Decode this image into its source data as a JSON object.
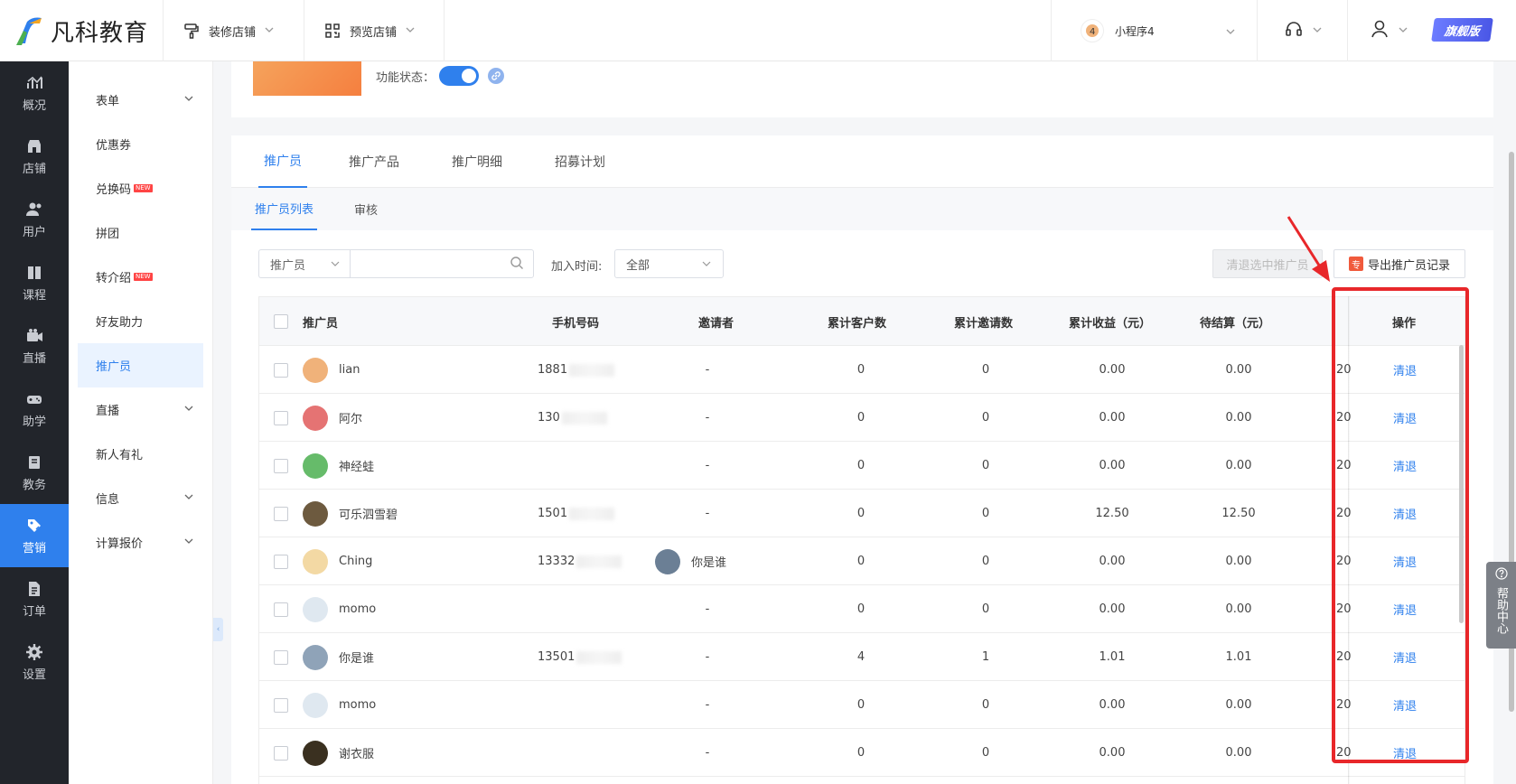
{
  "brand": {
    "name": "凡科教育"
  },
  "topnav": {
    "decorate": "装修店铺",
    "preview": "预览店铺"
  },
  "right": {
    "app_name": "小程序4",
    "badge": "旗舰版"
  },
  "sidebar": [
    {
      "label": "概况",
      "icon": "chart-line-icon"
    },
    {
      "label": "店铺",
      "icon": "store-icon"
    },
    {
      "label": "用户",
      "icon": "users-icon"
    },
    {
      "label": "课程",
      "icon": "book-icon"
    },
    {
      "label": "直播",
      "icon": "video-camera-icon"
    },
    {
      "label": "助学",
      "icon": "gamepad-icon"
    },
    {
      "label": "教务",
      "icon": "book-open-icon"
    },
    {
      "label": "营销",
      "icon": "tag-icon"
    },
    {
      "label": "订单",
      "icon": "document-icon"
    },
    {
      "label": "设置",
      "icon": "gear-icon"
    }
  ],
  "submenu": [
    {
      "label": "表单",
      "expandable": true
    },
    {
      "label": "优惠券"
    },
    {
      "label": "兑换码",
      "new": "NEW"
    },
    {
      "label": "拼团"
    },
    {
      "label": "转介绍",
      "new": "NEW"
    },
    {
      "label": "好友助力"
    },
    {
      "label": "推广员"
    },
    {
      "label": "直播",
      "expandable": true
    },
    {
      "label": "新人有礼"
    },
    {
      "label": "信息",
      "expandable": true
    },
    {
      "label": "计算报价",
      "expandable": true
    }
  ],
  "func": {
    "label": "功能状态：",
    "enabled": true
  },
  "tabs": [
    "推广员",
    "推广产品",
    "推广明细",
    "招募计划"
  ],
  "subtabs": [
    "推广员列表",
    "审核"
  ],
  "filter": {
    "type": "推广员",
    "search_placeholder": "",
    "join_label": "加入时间:",
    "join_value": "全部"
  },
  "buttons": {
    "bulk_remove": "清退选中推广员",
    "export_badge": "专",
    "export": "导出推广员记录"
  },
  "table": {
    "headers": [
      "推广员",
      "手机号码",
      "邀请者",
      "累计客户数",
      "累计邀请数",
      "累计收益（元）",
      "待结算（元）",
      "操作"
    ],
    "rows": [
      {
        "name": "lian",
        "phone": "1881",
        "inviter": "-",
        "customers": "0",
        "invites": "0",
        "income": "0.00",
        "pending": "0.00",
        "date": "20",
        "op": "清退",
        "avatar": "#f0b27a"
      },
      {
        "name": "阿尔",
        "phone": "130",
        "inviter": "-",
        "customers": "0",
        "invites": "0",
        "income": "0.00",
        "pending": "0.00",
        "date": "20",
        "op": "清退",
        "avatar": "#e57373"
      },
      {
        "name": "神经蛙",
        "phone": "",
        "inviter": "-",
        "customers": "0",
        "invites": "0",
        "income": "0.00",
        "pending": "0.00",
        "date": "20",
        "op": "清退",
        "avatar": "#66bb6a"
      },
      {
        "name": "可乐泗雪碧",
        "phone": "1501",
        "inviter": "-",
        "customers": "0",
        "invites": "0",
        "income": "12.50",
        "pending": "12.50",
        "date": "20",
        "op": "清退",
        "avatar": "#6d5a3f"
      },
      {
        "name": "Ching",
        "phone": "13332",
        "inviter": "你是谁",
        "customers": "0",
        "invites": "0",
        "income": "0.00",
        "pending": "0.00",
        "date": "20",
        "op": "清退",
        "avatar": "#f3d9a4"
      },
      {
        "name": "momo",
        "phone": "",
        "inviter": "-",
        "customers": "0",
        "invites": "0",
        "income": "0.00",
        "pending": "0.00",
        "date": "20",
        "op": "清退",
        "avatar": "#dfe8f0"
      },
      {
        "name": "你是谁",
        "phone": "13501",
        "inviter": "-",
        "customers": "4",
        "invites": "1",
        "income": "1.01",
        "pending": "1.01",
        "date": "20",
        "op": "清退",
        "avatar": "#8fa3b8"
      },
      {
        "name": "momo",
        "phone": "",
        "inviter": "-",
        "customers": "0",
        "invites": "0",
        "income": "0.00",
        "pending": "0.00",
        "date": "20",
        "op": "清退",
        "avatar": "#dfe8f0"
      },
      {
        "name": "谢衣服",
        "phone": "",
        "inviter": "-",
        "customers": "0",
        "invites": "0",
        "income": "0.00",
        "pending": "0.00",
        "date": "20",
        "op": "清退",
        "avatar": "#3a3020"
      }
    ]
  },
  "help": {
    "label": "帮助中心"
  },
  "colors": {
    "accent": "#2f80ed",
    "sidebar": "#22252b",
    "highlight": "#e8272a"
  }
}
